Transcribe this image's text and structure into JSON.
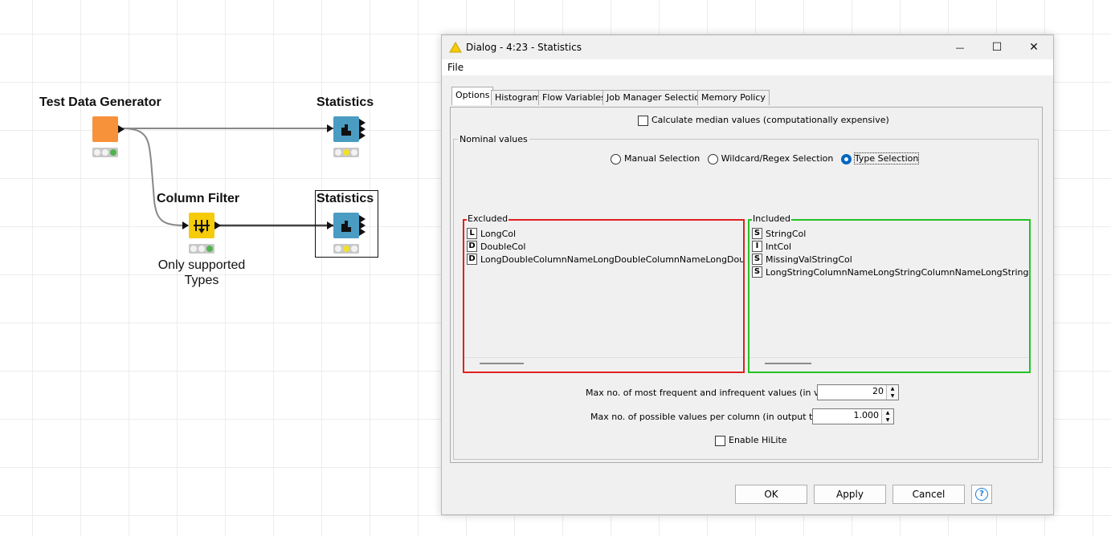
{
  "workflow": {
    "nodes": {
      "test_data_generator": {
        "title": "Test Data Generator",
        "color": "#f7923a"
      },
      "statistics_top": {
        "title": "Statistics",
        "color": "#4a9cc2"
      },
      "column_filter": {
        "title": "Column Filter",
        "color": "#f5cb0a",
        "annotation_line1": "Only supported",
        "annotation_line2": "Types"
      },
      "statistics_bottom": {
        "title": "Statistics",
        "color": "#4a9cc2"
      }
    }
  },
  "dialog": {
    "title": "Dialog - 4:23 - Statistics",
    "menu": {
      "file": "File"
    },
    "window_buttons": {
      "minimize": "—",
      "maximize": "☐",
      "close": "✕"
    },
    "tabs": [
      "Options",
      "Histogram",
      "Flow Variables",
      "Job Manager Selection",
      "Memory Policy"
    ],
    "active_tab": "Options",
    "options": {
      "median_checkbox_label": "Calculate median values (computationally expensive)",
      "median_checked": false,
      "nominal_group_label": "Nominal values",
      "radios": {
        "manual": "Manual Selection",
        "wildcard": "Wildcard/Regex Selection",
        "type": "Type Selection",
        "selected": "type"
      },
      "excluded": {
        "label": "Excluded",
        "border_color": "#e02020",
        "items": [
          {
            "type": "L",
            "name": "LongCol"
          },
          {
            "type": "D",
            "name": "DoubleCol"
          },
          {
            "type": "D",
            "name": "LongDoubleColumnNameLongDoubleColumnNameLongDoubleColumn"
          }
        ]
      },
      "included": {
        "label": "Included",
        "border_color": "#22c322",
        "items": [
          {
            "type": "S",
            "name": "StringCol"
          },
          {
            "type": "I",
            "name": "IntCol"
          },
          {
            "type": "S",
            "name": "MissingValStringCol"
          },
          {
            "type": "S",
            "name": "LongStringColumnNameLongStringColumnNameLongStringColumnNa"
          }
        ]
      },
      "max_frequent_label": "Max no. of most frequent and infrequent values (in view):",
      "max_frequent_value": "20",
      "max_possible_label": "Max no. of possible values per column (in output table):",
      "max_possible_value": "1.000",
      "hilite_label": "Enable HiLite",
      "hilite_checked": false
    },
    "buttons": {
      "ok": "OK",
      "apply": "Apply",
      "cancel": "Cancel",
      "help": "?"
    }
  }
}
